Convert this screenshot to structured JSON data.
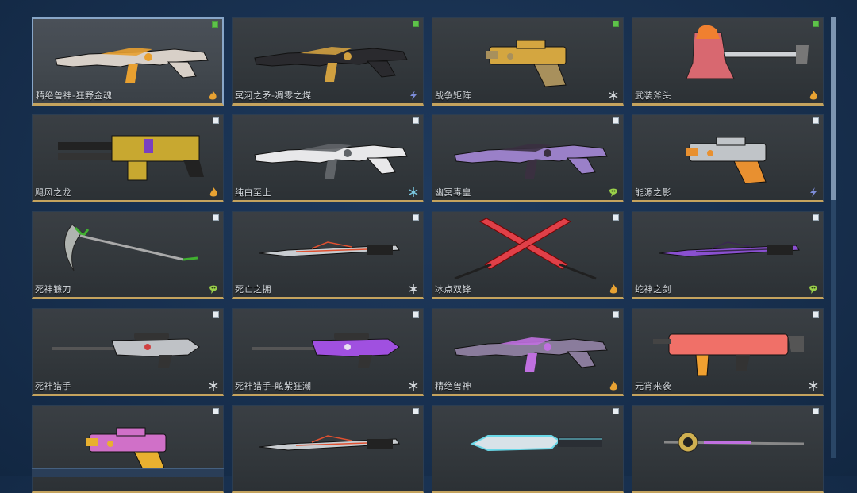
{
  "weapons": [
    {
      "name": "精绝兽神-狂野金魂",
      "checked": true,
      "selected": true,
      "element": "fire-icon",
      "shape": "rifle",
      "color": "#d8d0c8",
      "accent": "#e8a030"
    },
    {
      "name": "冥河之矛-凋零之煤",
      "checked": true,
      "selected": false,
      "element": "lightning-icon",
      "shape": "rifle",
      "color": "#2a2a2e",
      "accent": "#d0a040"
    },
    {
      "name": "战争矩阵",
      "checked": true,
      "selected": false,
      "element": "frost-icon",
      "shape": "pistol",
      "color": "#d4a640",
      "accent": "#a8905c"
    },
    {
      "name": "武装斧头",
      "checked": true,
      "selected": false,
      "element": "fire-icon",
      "shape": "axe",
      "color": "#d86870",
      "accent": "#f08030"
    },
    {
      "name": "飓风之龙",
      "checked": false,
      "selected": false,
      "element": "fire-icon",
      "shape": "minigun",
      "color": "#c8a830",
      "accent": "#222222"
    },
    {
      "name": "纯白至上",
      "checked": false,
      "selected": false,
      "element": "ice-icon",
      "shape": "rifle",
      "color": "#e8e8ea",
      "accent": "#606468"
    },
    {
      "name": "幽冥毒皇",
      "checked": false,
      "selected": false,
      "element": "poison-icon",
      "shape": "rifle",
      "color": "#9a80c8",
      "accent": "#3a3040"
    },
    {
      "name": "能源之影",
      "checked": false,
      "selected": false,
      "element": "lightning-icon",
      "shape": "pistol",
      "color": "#c0c4c8",
      "accent": "#e89030"
    },
    {
      "name": "死神镰刀",
      "checked": false,
      "selected": false,
      "element": "poison-icon",
      "shape": "scythe",
      "color": "#b0b4b0",
      "accent": "#40b030"
    },
    {
      "name": "死亡之拥",
      "checked": false,
      "selected": false,
      "element": "frost-icon",
      "shape": "sword",
      "color": "#c8ccd0",
      "accent": "#e05030"
    },
    {
      "name": "冰点双锋",
      "checked": false,
      "selected": false,
      "element": "fire-icon",
      "shape": "crossed",
      "color": "#e04048",
      "accent": "#202020"
    },
    {
      "name": "蛇神之剑",
      "checked": false,
      "selected": false,
      "element": "poison-icon",
      "shape": "sword",
      "color": "#8a50d0",
      "accent": "#3a2850"
    },
    {
      "name": "死神猎手",
      "checked": false,
      "selected": false,
      "element": "frost-icon",
      "shape": "sniper",
      "color": "#bfc2c6",
      "accent": "#d04040"
    },
    {
      "name": "死神猎手-眩紫狂潮",
      "checked": false,
      "selected": false,
      "element": "frost-icon",
      "shape": "sniper",
      "color": "#a050e0",
      "accent": "#e8e0f0"
    },
    {
      "name": "精绝兽神",
      "checked": false,
      "selected": false,
      "element": "fire-icon",
      "shape": "rifle",
      "color": "#8a7c9c",
      "accent": "#c070e0"
    },
    {
      "name": "元宵来袭",
      "checked": false,
      "selected": false,
      "element": "frost-icon",
      "shape": "smg",
      "color": "#f07068",
      "accent": "#f0a030"
    },
    {
      "name": "",
      "checked": false,
      "selected": false,
      "element": "",
      "shape": "pistol",
      "color": "#d070c8",
      "accent": "#e8b030"
    },
    {
      "name": "",
      "checked": false,
      "selected": false,
      "element": "",
      "shape": "sword",
      "color": "#c8ccd0",
      "accent": "#e05030"
    },
    {
      "name": "",
      "checked": false,
      "selected": false,
      "element": "",
      "shape": "knife",
      "color": "#6ad8e8",
      "accent": "#2a2e34"
    },
    {
      "name": "",
      "checked": false,
      "selected": false,
      "element": "",
      "shape": "staff",
      "color": "#c070e0",
      "accent": "#d0b050"
    }
  ]
}
